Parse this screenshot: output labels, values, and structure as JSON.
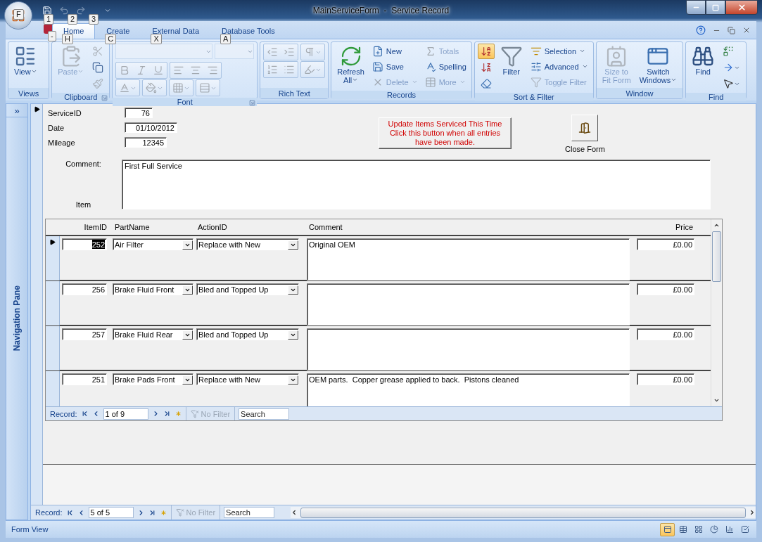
{
  "window": {
    "title": "MainServiceForm  -  Service Record"
  },
  "office_button": {
    "keytip": "F"
  },
  "quick_access": [
    {
      "keytip": "1",
      "disabled": false
    },
    {
      "keytip": "2",
      "disabled": true
    },
    {
      "keytip": "3",
      "disabled": true
    }
  ],
  "app_keytip": "-",
  "tabs": [
    {
      "label": "Home",
      "selected": true,
      "keytip": "H"
    },
    {
      "label": "Create",
      "selected": false,
      "keytip": "C"
    },
    {
      "label": "External Data",
      "selected": false,
      "keytip": "X"
    },
    {
      "label": "Database Tools",
      "selected": false,
      "keytip": "A"
    }
  ],
  "ribbon": {
    "groups": [
      {
        "label": "Views",
        "launcher": false,
        "columns": [
          [
            {
              "kind": "large",
              "lines": [
                "View"
              ],
              "dropdown": true,
              "disabled": false
            }
          ]
        ]
      },
      {
        "label": "Clipboard",
        "launcher": true,
        "columns": [
          [
            {
              "kind": "large",
              "lines": [
                "Paste"
              ],
              "dropdown": true,
              "disabled": true
            }
          ],
          [
            {
              "kind": "icon",
              "dropdown": false,
              "disabled": true
            },
            {
              "kind": "icon",
              "dropdown": false,
              "disabled": false
            },
            {
              "kind": "icon",
              "dropdown": false,
              "disabled": true
            }
          ]
        ]
      },
      {
        "label": "Font",
        "launcher": true,
        "columns": [
          [
            {
              "kind": "row",
              "items": [
                {
                  "kind": "combo",
                  "disabled": true
                },
                {
                  "kind": "combo",
                  "disabled": true
                }
              ]
            },
            {
              "kind": "row",
              "items": [
                {
                  "kind": "cluster",
                  "items": [
                    {
                      "kind": "icon",
                      "dropdown": false,
                      "disabled": true
                    },
                    {
                      "kind": "icon",
                      "dropdown": false,
                      "disabled": true
                    },
                    {
                      "kind": "icon",
                      "dropdown": false,
                      "disabled": true
                    }
                  ]
                },
                {
                  "kind": "cluster",
                  "items": [
                    {
                      "kind": "icon",
                      "dropdown": false,
                      "disabled": true
                    },
                    {
                      "kind": "icon",
                      "dropdown": false,
                      "disabled": true
                    },
                    {
                      "kind": "icon",
                      "dropdown": false,
                      "disabled": true
                    }
                  ]
                }
              ]
            },
            {
              "kind": "row",
              "items": [
                {
                  "kind": "cluster",
                  "items": [
                    {
                      "kind": "icon",
                      "dropdown": true,
                      "disabled": true
                    }
                  ]
                },
                {
                  "kind": "cluster",
                  "items": [
                    {
                      "kind": "icon",
                      "dropdown": true,
                      "disabled": true
                    }
                  ]
                },
                {
                  "kind": "cluster",
                  "items": [
                    {
                      "kind": "icon",
                      "dropdown": true,
                      "disabled": true
                    }
                  ]
                },
                {
                  "kind": "cluster",
                  "items": [
                    {
                      "kind": "icon",
                      "dropdown": true,
                      "disabled": true
                    }
                  ]
                }
              ]
            }
          ]
        ]
      },
      {
        "label": "Rich Text",
        "launcher": false,
        "columns": [
          [
            {
              "kind": "row",
              "items": [
                {
                  "kind": "cluster",
                  "items": [
                    {
                      "kind": "icon",
                      "dropdown": false,
                      "disabled": true
                    },
                    {
                      "kind": "icon",
                      "dropdown": false,
                      "disabled": true
                    }
                  ]
                },
                {
                  "kind": "cluster",
                  "items": [
                    {
                      "kind": "icon",
                      "dropdown": true,
                      "disabled": true
                    }
                  ]
                }
              ]
            },
            {
              "kind": "row",
              "items": [
                {
                  "kind": "cluster",
                  "items": [
                    {
                      "kind": "icon",
                      "dropdown": false,
                      "disabled": true
                    },
                    {
                      "kind": "icon",
                      "dropdown": false,
                      "disabled": true
                    }
                  ]
                },
                {
                  "kind": "cluster",
                  "items": [
                    {
                      "kind": "icon",
                      "dropdown": true,
                      "disabled": true
                    }
                  ]
                }
              ]
            }
          ]
        ]
      },
      {
        "label": "Records",
        "launcher": false,
        "columns": [
          [
            {
              "kind": "large",
              "lines": [
                "Refresh",
                "All"
              ],
              "dropdown": true,
              "disabled": false
            }
          ],
          [
            {
              "kind": "small",
              "label": "New",
              "dropdown": false,
              "disabled": false
            },
            {
              "kind": "small",
              "label": "Save",
              "dropdown": false,
              "disabled": false
            },
            {
              "kind": "small",
              "label": "Delete",
              "dropdown": true,
              "disabled": true
            }
          ],
          [
            {
              "kind": "small",
              "label": "Totals",
              "dropdown": false,
              "disabled": true
            },
            {
              "kind": "small",
              "label": "Spelling",
              "dropdown": false,
              "disabled": false
            },
            {
              "kind": "small",
              "label": "More",
              "dropdown": true,
              "disabled": true
            }
          ]
        ]
      },
      {
        "label": "Sort & Filter",
        "launcher": false,
        "columns": [
          [
            {
              "kind": "icon",
              "dropdown": false,
              "disabled": false,
              "selected": true
            },
            {
              "kind": "icon",
              "dropdown": false,
              "disabled": false,
              "selected": false
            },
            {
              "kind": "icon",
              "dropdown": false,
              "disabled": false,
              "selected": false
            }
          ],
          [
            {
              "kind": "large",
              "lines": [
                "Filter"
              ],
              "dropdown": false,
              "disabled": false
            }
          ],
          [
            {
              "kind": "small",
              "label": "Selection",
              "dropdown": true,
              "disabled": false
            },
            {
              "kind": "small",
              "label": "Advanced",
              "dropdown": true,
              "disabled": false
            },
            {
              "kind": "small",
              "label": "Toggle Filter",
              "dropdown": false,
              "disabled": true
            }
          ]
        ]
      },
      {
        "label": "Window",
        "launcher": false,
        "columns": [
          [
            {
              "kind": "large",
              "lines": [
                "Size to",
                "Fit Form"
              ],
              "dropdown": false,
              "disabled": true
            }
          ],
          [
            {
              "kind": "large",
              "lines": [
                "Switch",
                "Windows"
              ],
              "dropdown": true,
              "disabled": false
            }
          ]
        ]
      },
      {
        "label": "Find",
        "launcher": false,
        "columns": [
          [
            {
              "kind": "large",
              "lines": [
                "Find"
              ],
              "dropdown": false,
              "disabled": false
            }
          ],
          [
            {
              "kind": "icon",
              "dropdown": false,
              "disabled": false
            },
            {
              "kind": "icon",
              "dropdown": true,
              "disabled": false
            },
            {
              "kind": "icon",
              "dropdown": true,
              "disabled": false
            }
          ]
        ]
      }
    ]
  },
  "navigation_pane": {
    "toggle": "»",
    "label": "Navigation Pane"
  },
  "form": {
    "fields": [
      {
        "label": "ServiceID",
        "value": "76"
      },
      {
        "label": "Date",
        "value": "01/10/2012"
      },
      {
        "label": "Mileage",
        "value": "12345"
      }
    ],
    "comment": {
      "label": "Comment:",
      "value": "First Full Service"
    },
    "item_label": "Item",
    "update_button": {
      "lines": [
        "Update Items Serviced This Time",
        "Click this button when all entries have been made."
      ]
    },
    "close_button": {
      "label": "Close Form"
    },
    "subform": {
      "columns": [
        "ItemID",
        "PartName",
        "ActionID",
        "Comment",
        "Price"
      ],
      "rows": [
        {
          "item_id": "252",
          "part": "Air Filter",
          "action": "Replace with New",
          "comment": "Original OEM",
          "price": "£0.00",
          "selected": true
        },
        {
          "item_id": "256",
          "part": "Brake Fluid Front",
          "action": "Bled and Topped Up",
          "price": "£0.00",
          "selected": false
        },
        {
          "item_id": "257",
          "part": "Brake Fluid Rear",
          "action": "Bled and Topped Up",
          "price": "£0.00",
          "selected": false
        },
        {
          "item_id": "251",
          "part": "Brake Pads Front",
          "action": "Replace with New",
          "comment": "OEM parts.  Copper grease applied to back.  Pistons cleaned",
          "price": "£0.00",
          "selected": false
        }
      ],
      "navigation": {
        "label": "Record:",
        "position": "1 of 9",
        "filter": "No Filter",
        "filter_active": false,
        "search_placeholder": "Search"
      }
    }
  },
  "record_navigation": {
    "label": "Record:",
    "position": "5 of 5",
    "filter": "No Filter",
    "filter_active": false,
    "search_placeholder": "Search"
  },
  "status_bar": {
    "text": "Form View",
    "views": [
      {
        "selected": true
      },
      {
        "selected": false
      },
      {
        "selected": false
      },
      {
        "selected": false
      },
      {
        "selected": false
      },
      {
        "selected": false
      }
    ]
  }
}
